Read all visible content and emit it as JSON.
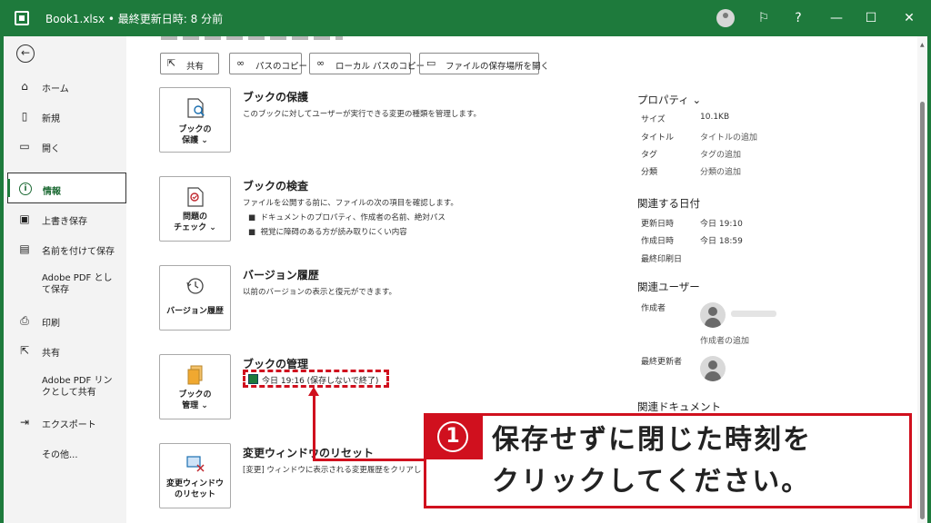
{
  "titlebar": {
    "title": "Book1.xlsx • 最終更新日時: 8 分前",
    "help": "?",
    "minimize": "—",
    "maximize": "☐",
    "close": "✕"
  },
  "nav": {
    "back": "←",
    "items": [
      {
        "label": "ホーム",
        "icon": "home-icon"
      },
      {
        "label": "新規",
        "icon": "new-doc-icon"
      },
      {
        "label": "開く",
        "icon": "folder-icon"
      },
      {
        "label": "情報",
        "icon": "info-icon"
      },
      {
        "label": "上書き保存",
        "icon": "save-icon"
      },
      {
        "label": "名前を付けて保存",
        "icon": "save-as-icon"
      },
      {
        "label": "Adobe PDF として保存"
      },
      {
        "label": "印刷",
        "icon": "print-icon"
      },
      {
        "label": "共有",
        "icon": "share-icon"
      },
      {
        "label": "Adobe PDF リンクとして共有"
      },
      {
        "label": "エクスポート",
        "icon": "export-icon"
      },
      {
        "label": "その他..."
      }
    ]
  },
  "toolbar": {
    "share": "共有",
    "copy_path": "パスのコピー",
    "copy_local_path": "ローカル パスのコピー",
    "open_location": "ファイルの保存場所を開く"
  },
  "sections": {
    "protect": {
      "button_line1": "ブックの",
      "button_line2": "保護 ⌄",
      "title": "ブックの保護",
      "desc": "このブックに対してユーザーが実行できる変更の種類を管理します。"
    },
    "inspect": {
      "button_line1": "問題の",
      "button_line2": "チェック ⌄",
      "title": "ブックの検査",
      "desc": "ファイルを公開する前に、ファイルの次の項目を確認します。",
      "bullets": [
        "ドキュメントのプロパティ、作成者の名前、絶対パス",
        "視覚に障碍のある方が読み取りにくい内容"
      ]
    },
    "history": {
      "button_line1": "バージョン履歴",
      "title": "バージョン履歴",
      "desc": "以前のバージョンの表示と復元ができます。"
    },
    "manage": {
      "button_line1": "ブックの",
      "button_line2": "管理 ⌄",
      "title": "ブックの管理",
      "version_entry": "今日 19:16 (保存しないで終了)"
    },
    "reset": {
      "button_line1": "変更ウィンドウ",
      "button_line2": "のリセット",
      "title": "変更ウィンドウのリセット",
      "desc": "[変更] ウィンドウに表示される変更履歴をクリアし"
    }
  },
  "properties": {
    "header": "プロパティ ⌄",
    "rows": [
      {
        "label": "サイズ",
        "value": "10.1KB"
      },
      {
        "label": "タイトル",
        "value": "タイトルの追加"
      },
      {
        "label": "タグ",
        "value": "タグの追加"
      },
      {
        "label": "分類",
        "value": "分類の追加"
      }
    ],
    "dates_header": "関連する日付",
    "dates": [
      {
        "label": "更新日時",
        "value": "今日 19:10"
      },
      {
        "label": "作成日時",
        "value": "今日 18:59"
      },
      {
        "label": "最終印刷日",
        "value": ""
      }
    ],
    "users_header": "関連ユーザー",
    "author_label": "作成者",
    "add_author": "作成者の追加",
    "last_modified_by": "最終更新者",
    "docs_header": "関連ドキュメント"
  },
  "callout": {
    "number": "1",
    "line1": "保存せずに閉じた時刻を",
    "line2": "クリックしてください。"
  },
  "colors": {
    "excel_green": "#1e7a3c",
    "annotation_red": "#d0101e"
  }
}
